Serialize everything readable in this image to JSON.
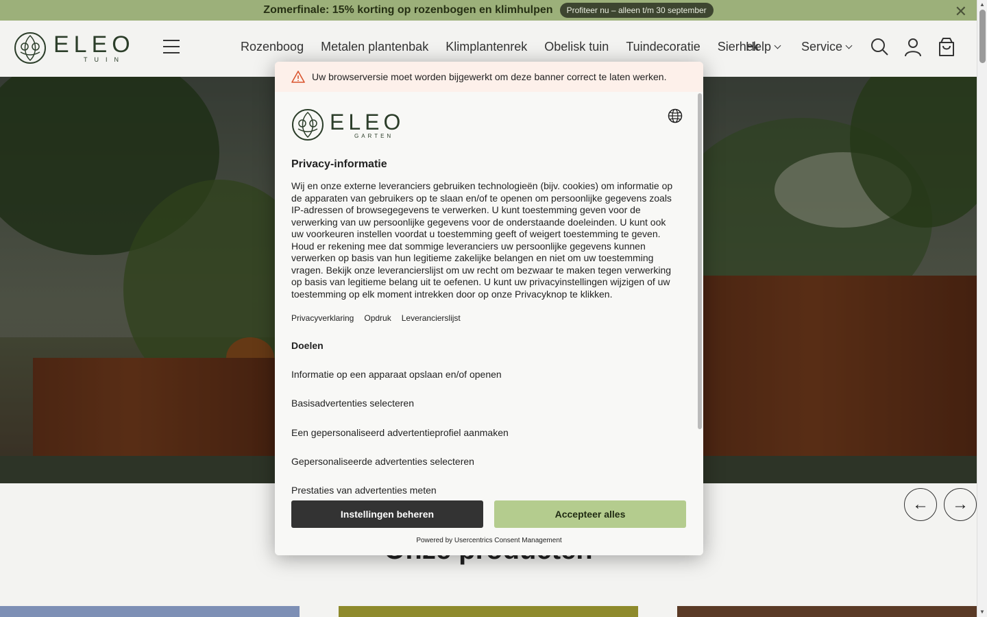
{
  "promo": {
    "text": "Zomerfinale: 15% korting op rozenbogen en klimhulpen",
    "cta": "Profiteer nu – alleen t/m 30 september",
    "close": "✕"
  },
  "header": {
    "logo_main": "ELEO",
    "logo_sub": "TUIN",
    "nav": [
      "Rozenboog",
      "Metalen plantenbak",
      "Klimplantenrek",
      "Obelisk tuin",
      "Tuindecoratie",
      "Sierhek"
    ],
    "help": "Help",
    "service": "Service"
  },
  "carousel": {
    "prev": "←",
    "next": "→"
  },
  "products_title": "Onze producten",
  "consent": {
    "warning": "Uw browserversie moet worden bijgewerkt om deze banner correct te laten werken.",
    "logo_main": "ELEO",
    "logo_sub": "GARTEN",
    "title": "Privacy-informatie",
    "body": "Wij en onze externe leveranciers gebruiken technologieën (bijv. cookies) om informatie op de apparaten van gebruikers op te slaan en/of te openen om persoonlijke gegevens zoals IP-adressen of browsegegevens te verwerken. U kunt toestemming geven voor de verwerking van uw persoonlijke gegevens voor de onderstaande doeleinden. U kunt ook uw voorkeuren instellen voordat u toestemming geeft of weigert toestemming te geven. Houd er rekening mee dat sommige leveranciers uw persoonlijke gegevens kunnen verwerken op basis van hun legitieme zakelijke belangen en niet om uw toestemming vragen. Bekijk onze leverancierslijst om uw recht om bezwaar te maken tegen verwerking op basis van legitieme belang uit te oefenen. U kunt uw privacyinstellingen wijzigen of uw toestemming op elk moment intrekken door op onze Privacyknop te klikken.",
    "links": [
      "Privacyverklaring",
      "Opdruk",
      "Leverancierslijst"
    ],
    "purposes_title": "Doelen",
    "purposes": [
      "Informatie op een apparaat opslaan en/of openen",
      "Basisadvertenties selecteren",
      "Een gepersonaliseerd advertentieprofiel aanmaken",
      "Gepersonaliseerde advertenties selecteren",
      "Prestaties van advertenties meten"
    ],
    "btn_settings": "Instellingen beheren",
    "btn_accept": "Accepteer alles",
    "powered": "Powered by Usercentrics Consent Management"
  }
}
